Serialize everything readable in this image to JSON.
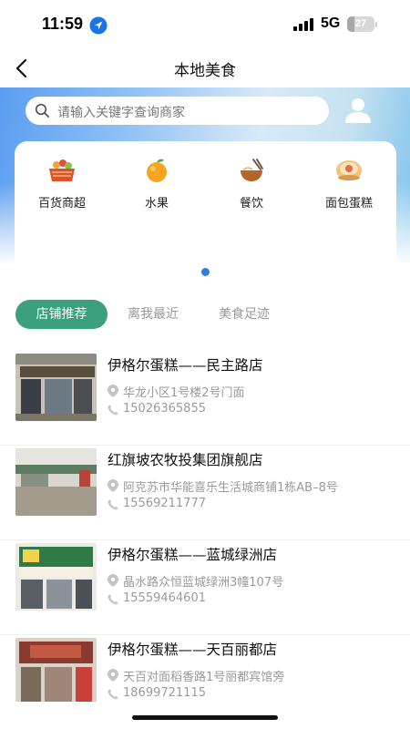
{
  "status_bar": {
    "time": "11:59",
    "network": "5G",
    "battery": "27",
    "battery_level": 0.27
  },
  "nav": {
    "title": "本地美食"
  },
  "search": {
    "placeholder": "请输入关键字查询商家"
  },
  "categories": [
    {
      "label": "百货商超",
      "icon": "grocery-basket-icon"
    },
    {
      "label": "水果",
      "icon": "orange-fruit-icon"
    },
    {
      "label": "餐饮",
      "icon": "noodle-bowl-icon"
    },
    {
      "label": "面包蛋糕",
      "icon": "cake-icon"
    }
  ],
  "tabs": [
    {
      "label": "店铺推荐",
      "active": true
    },
    {
      "label": "离我最近",
      "active": false
    },
    {
      "label": "美食足迹",
      "active": false
    }
  ],
  "stores": [
    {
      "name": "伊格尔蛋糕——民主路店",
      "address": "华龙小区1号楼2号门面",
      "phone": "15026365855"
    },
    {
      "name": "红旗坡农牧投集团旗舰店",
      "address": "阿克苏市华能喜乐生活城商铺1栋AB–8号",
      "phone": "15569211777"
    },
    {
      "name": "伊格尔蛋糕——蓝城绿洲店",
      "address": "晶水路众恒蓝城绿洲3幢107号",
      "phone": "15559464601"
    },
    {
      "name": "伊格尔蛋糕——天百丽都店",
      "address": "天百对面稻香路1号丽都宾馆旁",
      "phone": "18699721115"
    }
  ],
  "colors": {
    "accent_green": "#3aa07d",
    "pager_blue": "#2a7fe0"
  }
}
